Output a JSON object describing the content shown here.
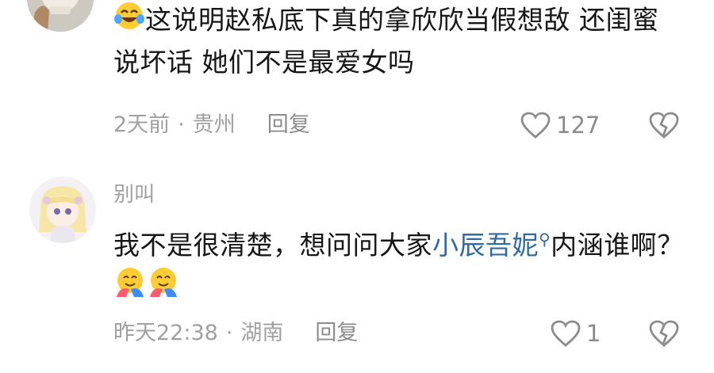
{
  "comment1": {
    "text": "这说明赵私底下真的拿欣欣当假想敌 还闺蜜说坏话 她们不是最爱女吗",
    "emoji": "crying-laughing-emoji",
    "time": "2天前",
    "location": "贵州",
    "reply_label": "回复",
    "likes": "127"
  },
  "comment2": {
    "username": "别叫",
    "text_before": "我不是很清楚，想问问大家",
    "mention": "小辰吾妮",
    "text_after": "内涵谁啊？",
    "emoji": "hugging-face-emoji",
    "time": "昨天22:38",
    "location": "湖南",
    "reply_label": "回复",
    "likes": "1"
  },
  "colors": {
    "mention": "#2f6aa3",
    "meta": "#a0a0a0",
    "text": "#161616"
  }
}
